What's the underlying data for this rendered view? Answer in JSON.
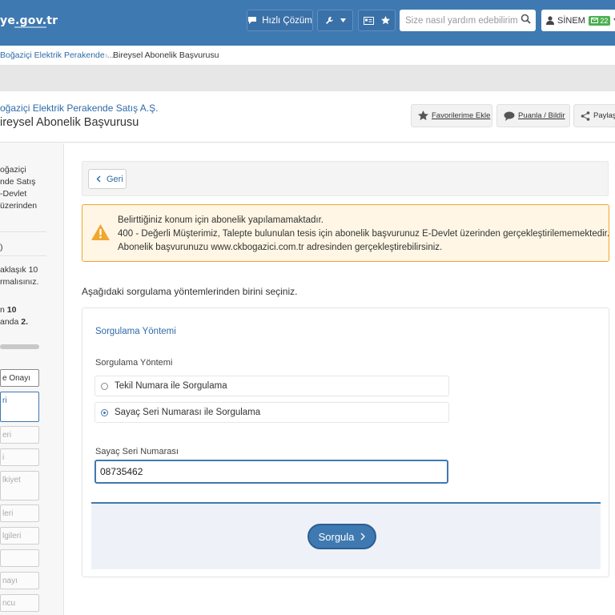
{
  "topbar": {
    "logo_text": "ye.gov.tr",
    "quick_solution_label": "Hızlı Çözüm",
    "search_placeholder": "Size nasıl yardım edebilirim",
    "user_name": "SİNEM",
    "mail_count": "22"
  },
  "breadcrumb": {
    "items": [
      "Boğaziçi Elektrik Perakende ...",
      "Bireysel Abonelik Başvurusu"
    ]
  },
  "header": {
    "org_name": "oğaziçi Elektrik Perakende Satış A.Ş.",
    "service_title": "ireysel Abonelik Başvurusu",
    "favorites_label": "Favorilerime Ekle",
    "rate_label": "Puanla / Bildir",
    "share_label": "Paylaş"
  },
  "sidebar": {
    "intro_lines": [
      "oğaziçi",
      "nde Satış",
      "-Devlet",
      "üzerinden"
    ],
    "single_char": ")",
    "duration_lines": [
      "aklaşık 10",
      "rmalısınız."
    ],
    "steps_prefix": "n",
    "steps_total": "10",
    "steps_current_prefix": "anda",
    "steps_current": "2.",
    "progress": 0.2,
    "steps": [
      "e Onayı",
      "ri",
      "eri",
      "i",
      "lkiyet",
      "leri",
      "lgileri",
      "",
      "nayı",
      "ncu"
    ]
  },
  "content": {
    "back_label": "Geri",
    "warning_lines": [
      "Belirttiğiniz konum için abonelik yapılamamaktadır.",
      "400 - Değerli Müşterimiz, Talepte bulunulan tesis için abonelik başvurunuz E-Devlet üzerinden gerçekleştirilememektedir.",
      "Abonelik başvurunuzu www.ckbogazici.com.tr adresinden gerçekleştirebilirsiniz."
    ],
    "intro_text": "Aşağıdaki sorgulama yöntemlerinden birini seçiniz.",
    "card_title": "Sorgulama Yöntemi",
    "method_label": "Sorgulama Yöntemi",
    "options": [
      "Tekil Numara ile Sorgulama",
      "Sayaç Seri Numarası ile Sorgulama"
    ],
    "selected_option": "Sayaç Seri Numarası ile Sorgulama",
    "serial_label": "Sayaç Seri Numarası",
    "serial_value": "08735462",
    "submit_label": "Sorgula"
  },
  "colors": {
    "brand_blue": "#3f79b1",
    "link_blue": "#2e6aa8",
    "warning_border": "#f0a630",
    "warning_bg": "#fff6e5",
    "mail_green": "#4caf50"
  }
}
